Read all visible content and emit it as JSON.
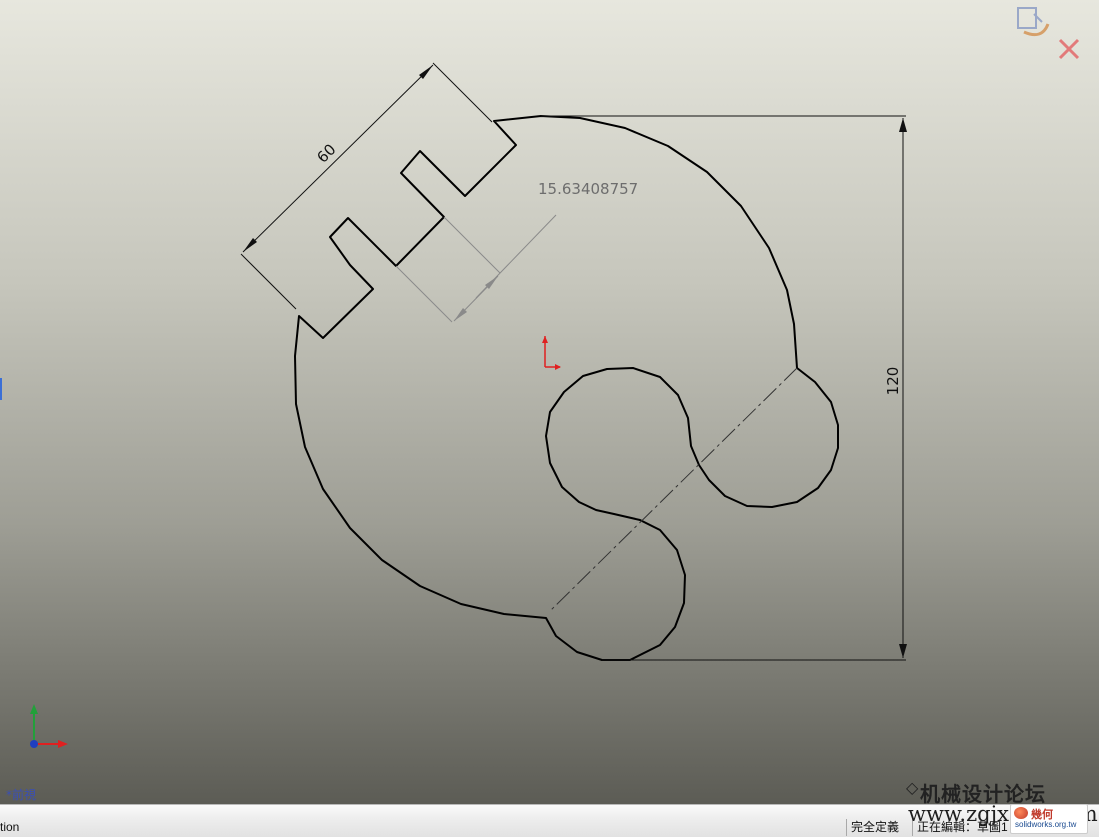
{
  "viewport": {
    "view_label": "*前視",
    "background_top": "#e7e7de",
    "background_bottom": "#5c5c55"
  },
  "dimensions": {
    "width": "60",
    "reference": "15.63408757",
    "height": "120"
  },
  "colors": {
    "sketch_line": "#000000",
    "reference_line": "#8a8a8a",
    "origin_red": "#e02020",
    "triad_x": "#e02020",
    "triad_y": "#22a03a",
    "triad_z": "#1f3fc0"
  },
  "icons": {
    "confirm_corner_rebuild": "rebuild-exit-sketch-icon",
    "confirm_corner_cancel": "cancel-x-icon",
    "sketch_origin": "sketch-origin-icon",
    "view_triad": "axis-triad-icon"
  },
  "statusbar": {
    "left_text": "tion",
    "definition_status": "完全定義",
    "editing_status": "正在編輯：草圖1"
  },
  "watermark": {
    "line1": "机械设计论坛",
    "line2": "www.zgjxcad.com",
    "badge_title": "幾何",
    "badge_url": "solidworks.org.tw"
  }
}
